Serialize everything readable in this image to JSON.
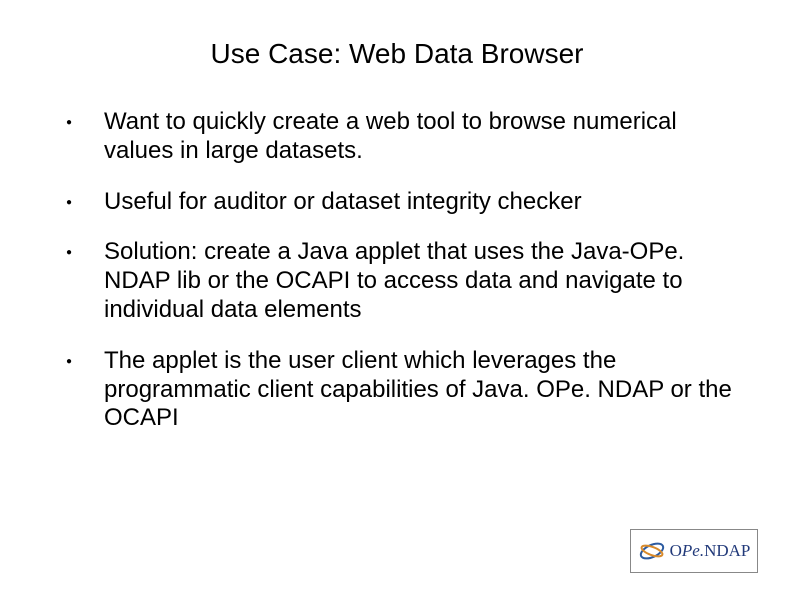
{
  "title": "Use Case: Web Data Browser",
  "bullets": {
    "b0": "Want to quickly create a web tool to browse numerical values in large datasets.",
    "b1": "Useful for auditor or dataset integrity checker",
    "b2": "Solution: create a Java applet that uses the Java-OPe. NDAP lib or the OCAPI to access data and navigate to individual data elements",
    "b3": "The applet is the user client which leverages the programmatic client capabilities of Java. OPe. NDAP or the OCAPI"
  },
  "logo": {
    "prefix": "O",
    "italic": "Pe.",
    "suffix": "NDAP"
  }
}
